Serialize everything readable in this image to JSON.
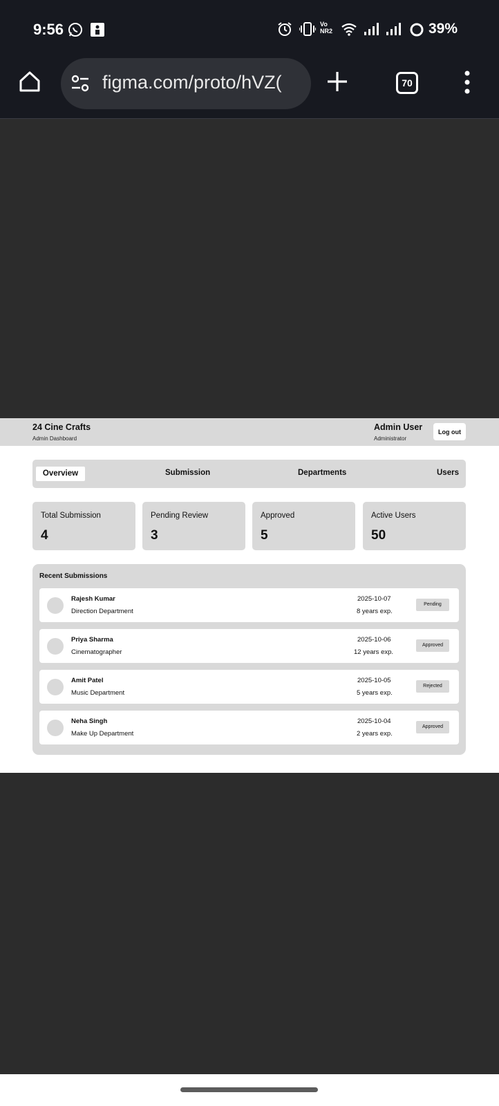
{
  "status_bar": {
    "time": "9:56",
    "network_label": "Vo NR2",
    "battery": "39%",
    "icons": [
      "whatsapp-icon",
      "notification-icon",
      "alarm-icon",
      "vibrate-icon",
      "volte-icon",
      "wifi-icon",
      "signal-icon",
      "battery-icon"
    ]
  },
  "browser": {
    "url": "figma.com/proto/hVZ(",
    "tab_count": "70",
    "icons": [
      "home-icon",
      "site-settings-icon",
      "new-tab-icon",
      "tabs-icon",
      "menu-icon"
    ]
  },
  "app": {
    "brand": "24 Cine Crafts",
    "brand_sub": "Admin Dashboard",
    "user_name": "Admin User",
    "user_role": "Administrator",
    "logout_label": "Log out",
    "tabs": [
      {
        "label": "Overview",
        "active": true
      },
      {
        "label": "Submission",
        "active": false
      },
      {
        "label": "Departments",
        "active": false
      },
      {
        "label": "Users",
        "active": false
      }
    ],
    "stats": [
      {
        "label": "Total Submission",
        "value": "4"
      },
      {
        "label": "Pending Review",
        "value": "3"
      },
      {
        "label": "Approved",
        "value": "5"
      },
      {
        "label": "Active Users",
        "value": "50"
      }
    ],
    "recent_title": "Recent Submissions",
    "submissions": [
      {
        "name": "Rajesh Kumar",
        "department": "Direction Department",
        "date": "2025-10-07",
        "experience": "8 years exp.",
        "status": "Pending"
      },
      {
        "name": "Priya Sharma",
        "department": "Cinematographer",
        "date": "2025-10-06",
        "experience": "12 years exp.",
        "status": "Approved"
      },
      {
        "name": "Amit Patel",
        "department": "Music Department",
        "date": "2025-10-05",
        "experience": "5 years exp.",
        "status": "Rejected"
      },
      {
        "name": "Neha Singh",
        "department": "Make Up Department",
        "date": "2025-10-04",
        "experience": "2 years exp.",
        "status": "Approved"
      }
    ]
  },
  "colors": {
    "system_bar": "#171920",
    "canvas": "#2c2c2c",
    "panel_gray": "#d9d9d9",
    "surface": "#ffffff"
  }
}
